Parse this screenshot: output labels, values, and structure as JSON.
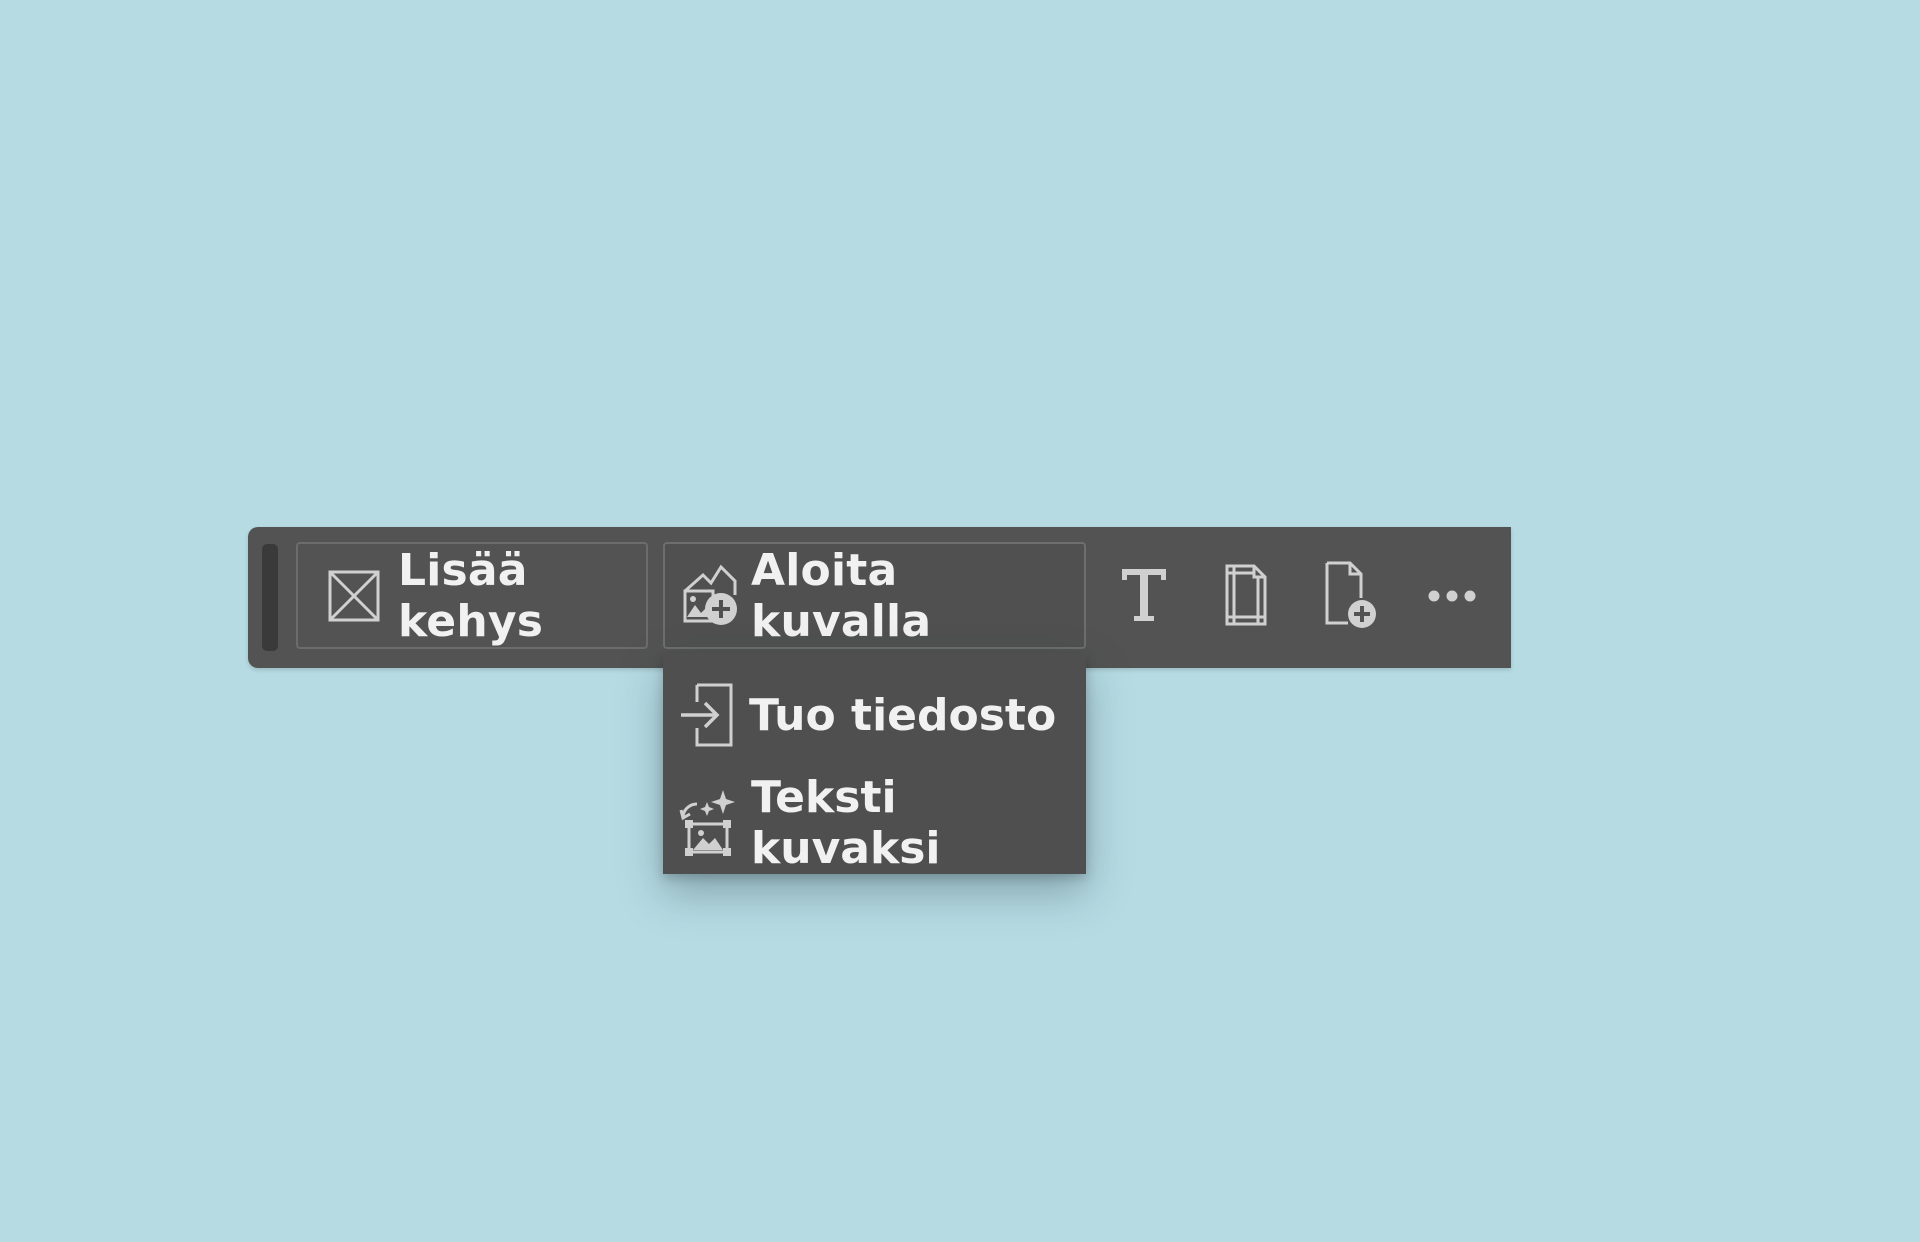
{
  "toolbar": {
    "add_frame_label": "Lisää kehys",
    "start_with_image_label": "Aloita kuvalla",
    "icons": [
      "frame-icon",
      "image-add-icon",
      "text-icon",
      "page-icon",
      "add-page-icon",
      "more-icon"
    ]
  },
  "dropdown": {
    "items": [
      {
        "label": "Tuo tiedosto",
        "icon": "import-file-icon"
      },
      {
        "label": "Teksti kuvaksi",
        "icon": "text-to-image-icon"
      }
    ]
  },
  "colors": {
    "background": "#b6dbe3",
    "toolbar": "#535353",
    "text": "#f1f1f1",
    "icon": "#c9c9c9"
  }
}
